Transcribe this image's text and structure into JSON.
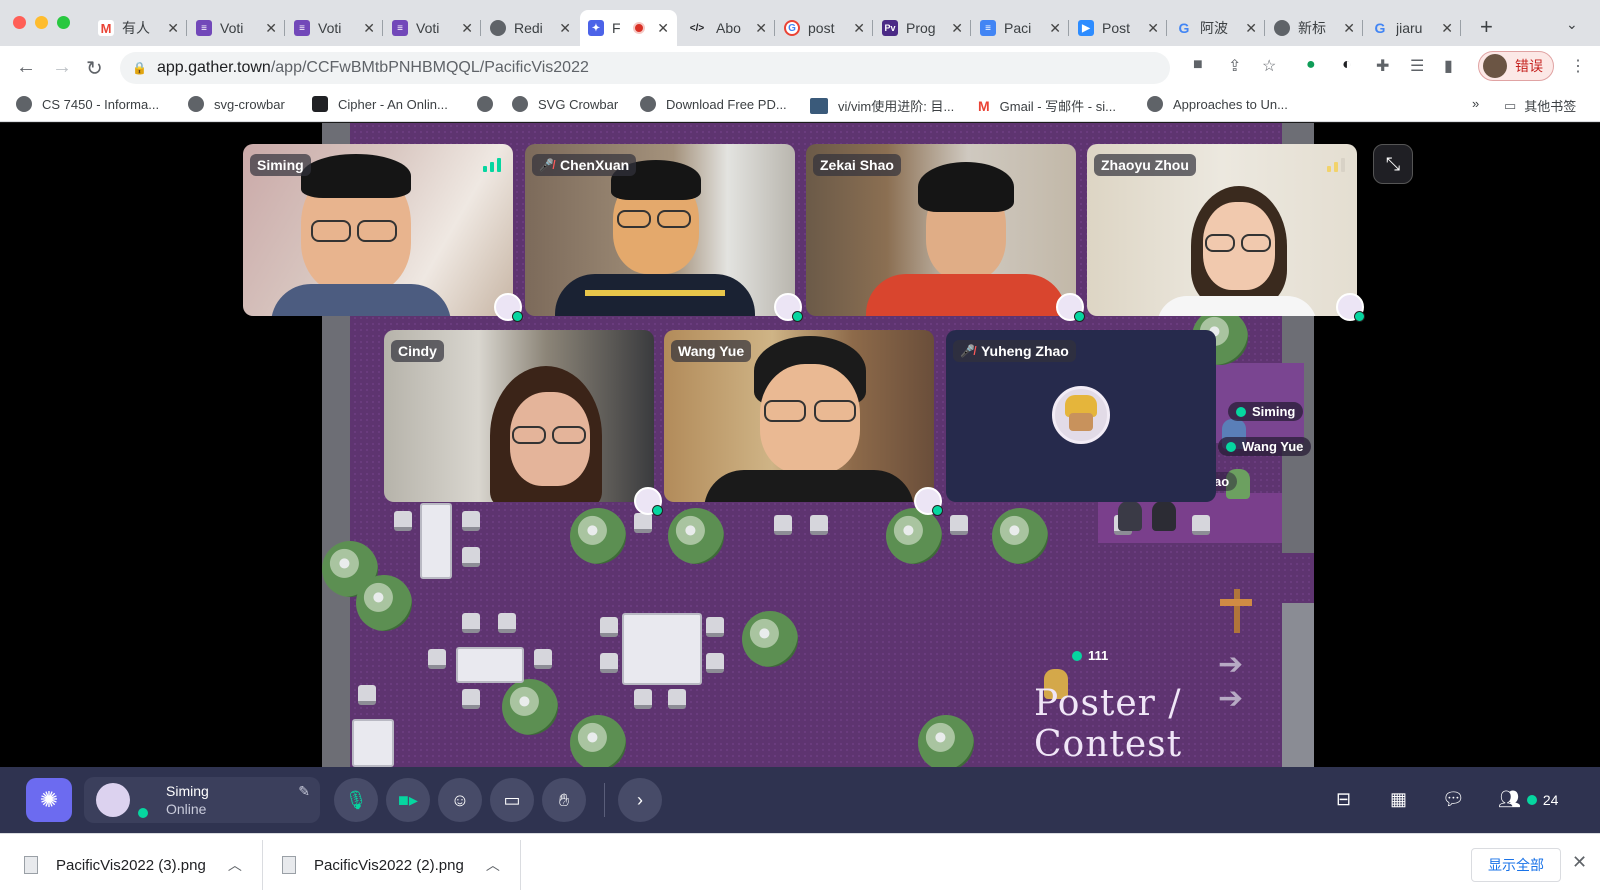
{
  "tabs": [
    {
      "label": "有人",
      "icon": "gmail-icon",
      "color": "#ea4335"
    },
    {
      "label": "Voti",
      "icon": "forms-icon",
      "color": "#7248b9"
    },
    {
      "label": "Voti",
      "icon": "forms-icon",
      "color": "#7248b9"
    },
    {
      "label": "Voti",
      "icon": "forms-icon",
      "color": "#7248b9"
    },
    {
      "label": "Redi",
      "icon": "globe-icon",
      "color": "#5f6368"
    },
    {
      "label": "F",
      "icon": "gather-icon",
      "color": "#4c63e8"
    },
    {
      "label": "Abo",
      "icon": "code-icon",
      "color": "#202124"
    },
    {
      "label": "post",
      "icon": "google-icon",
      "color": "#4285f4"
    },
    {
      "label": "Prog",
      "icon": "pv-icon",
      "color": "#4b2a86"
    },
    {
      "label": "Paci",
      "icon": "docs-icon",
      "color": "#4285f4"
    },
    {
      "label": "Post",
      "icon": "zoom-icon",
      "color": "#2d8cff"
    },
    {
      "label": "阿波",
      "icon": "google-icon",
      "color": "#4285f4"
    },
    {
      "label": "新标",
      "icon": "chrome-icon",
      "color": "#5f6368"
    },
    {
      "label": "jiaru",
      "icon": "google-icon",
      "color": "#4285f4"
    }
  ],
  "address": {
    "domain": "app.gather.town",
    "path": "/app/CCFwBMtbPNHBMQQL/PacificVis2022"
  },
  "profile": {
    "label": "错误"
  },
  "bookmarks": [
    {
      "label": "CS 7450 - Informa..."
    },
    {
      "label": "svg-crowbar"
    },
    {
      "label": "Cipher - An Onlin..."
    },
    {
      "label": ""
    },
    {
      "label": "SVG Crowbar"
    },
    {
      "label": "Download Free PD..."
    },
    {
      "label": "vi/vim使用进阶: 目..."
    },
    {
      "label": "Gmail - 写邮件 - si..."
    },
    {
      "label": "Approaches to Un..."
    }
  ],
  "bookmarks_more": "»",
  "other_bookmarks": "其他书签",
  "video_tiles": [
    {
      "name": "Siming",
      "muted": false,
      "signal": true
    },
    {
      "name": "ChenXuan",
      "muted": true
    },
    {
      "name": "Zekai Shao",
      "muted": false
    },
    {
      "name": "Zhaoyu Zhou",
      "muted": false,
      "signal": true
    },
    {
      "name": "Cindy",
      "muted": false
    },
    {
      "name": "Wang Yue",
      "muted": false
    },
    {
      "name": "Yuheng Zhao",
      "muted": true
    }
  ],
  "map_labels": {
    "siming": "Siming",
    "wangyue": "Wang Yue",
    "partial": "ao",
    "player111": "111",
    "poster": "Poster / Contest"
  },
  "user": {
    "name": "Siming",
    "status": "Online"
  },
  "participants_count": "24",
  "downloads": [
    {
      "filename": "PacificVis2022 (3).png"
    },
    {
      "filename": "PacificVis2022 (2).png"
    }
  ],
  "show_all": "显示全部",
  "colors": {
    "accent_green": "#06d6a0",
    "gather_bar": "#2f3350",
    "map_floor": "#5e3470"
  }
}
